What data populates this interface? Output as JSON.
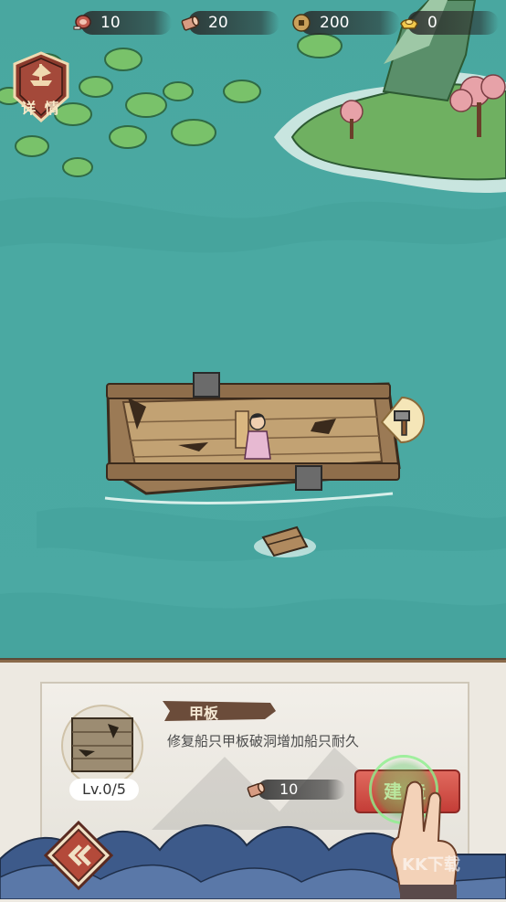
{
  "resources": {
    "meat": {
      "icon": "meat-icon",
      "value": "10"
    },
    "wood": {
      "icon": "wood-log-icon",
      "value": "20"
    },
    "coin": {
      "icon": "copper-coin-icon",
      "value": "200"
    },
    "gold": {
      "icon": "gold-ingot-icon",
      "value": "0"
    }
  },
  "details_badge": {
    "label": "详 情",
    "icon": "ship-icon"
  },
  "ship": {
    "repair_icon": "hammer-icon"
  },
  "panel": {
    "part_name": "甲板",
    "description": "修复船只甲板破洞增加船只耐久",
    "level": "Lv.0/5",
    "cost_icon": "wood-log-icon",
    "cost_value": "10",
    "build_label": "建造",
    "back_icon": "double-chevron-left-icon"
  },
  "watermark": "KK下载",
  "colors": {
    "sea": "#4aa6a0",
    "build_button": "#d2514a",
    "panel": "#ede9e1"
  }
}
